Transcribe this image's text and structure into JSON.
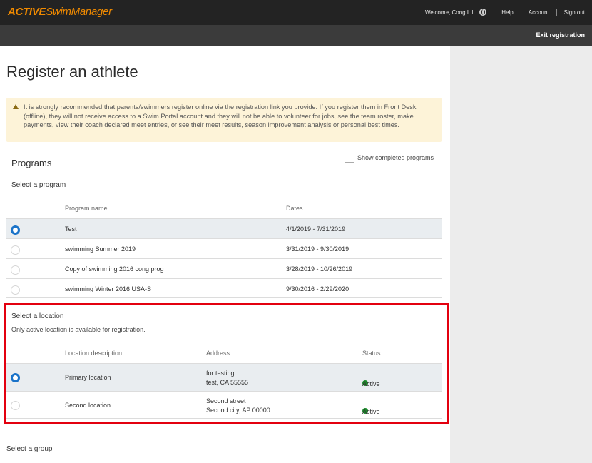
{
  "header": {
    "logo_bold": "ACTIVE",
    "logo_thin": "SwimManager",
    "welcome": "Welcome, Cong LIl",
    "help": "Help",
    "account": "Account",
    "sign_out": "Sign out",
    "exit_registration": "Exit registration"
  },
  "page": {
    "title": "Register an athlete",
    "alert_text": "It is strongly recommended that parents/swimmers register online via the registration link you provide. If you register them in Front Desk (offline), they will not receive access to a Swim Portal account and they will not be able to volunteer for jobs, see the team roster, make payments, view their coach declared meet entries, or see their meet results, season improvement analysis or personal best times."
  },
  "programs": {
    "heading": "Programs",
    "show_completed_label": "Show completed programs",
    "show_completed_checked": false,
    "select_label": "Select a program",
    "columns": [
      "Program name",
      "Dates"
    ],
    "rows": [
      {
        "name": "Test",
        "dates": "4/1/2019 - 7/31/2019",
        "selected": true
      },
      {
        "name": "swimming Summer 2019",
        "dates": "3/31/2019 - 9/30/2019",
        "selected": false
      },
      {
        "name": "Copy of swimming 2016 cong prog",
        "dates": "3/28/2019 - 10/26/2019",
        "selected": false
      },
      {
        "name": "swimming Winter 2016 USA-S",
        "dates": "9/30/2016 - 2/29/2020",
        "selected": false
      }
    ]
  },
  "locations": {
    "heading": "Select a location",
    "note": "Only active location is available for registration.",
    "columns": [
      "Location description",
      "Address",
      "Status"
    ],
    "rows": [
      {
        "description": "Primary location",
        "address_line1": "for testing",
        "address_line2": "test, CA 55555",
        "status": "Active",
        "selected": true
      },
      {
        "description": "Second location",
        "address_line1": "Second street",
        "address_line2": "Second city, AP 00000",
        "status": "Active",
        "selected": false
      }
    ],
    "status_color": "#1a8a2a"
  },
  "groups": {
    "heading": "Select a group"
  },
  "colors": {
    "accent": "#1a73c9",
    "logo": "#f08a00",
    "highlight_box": "#e3000f",
    "alert_bg": "#fdf3d8"
  }
}
